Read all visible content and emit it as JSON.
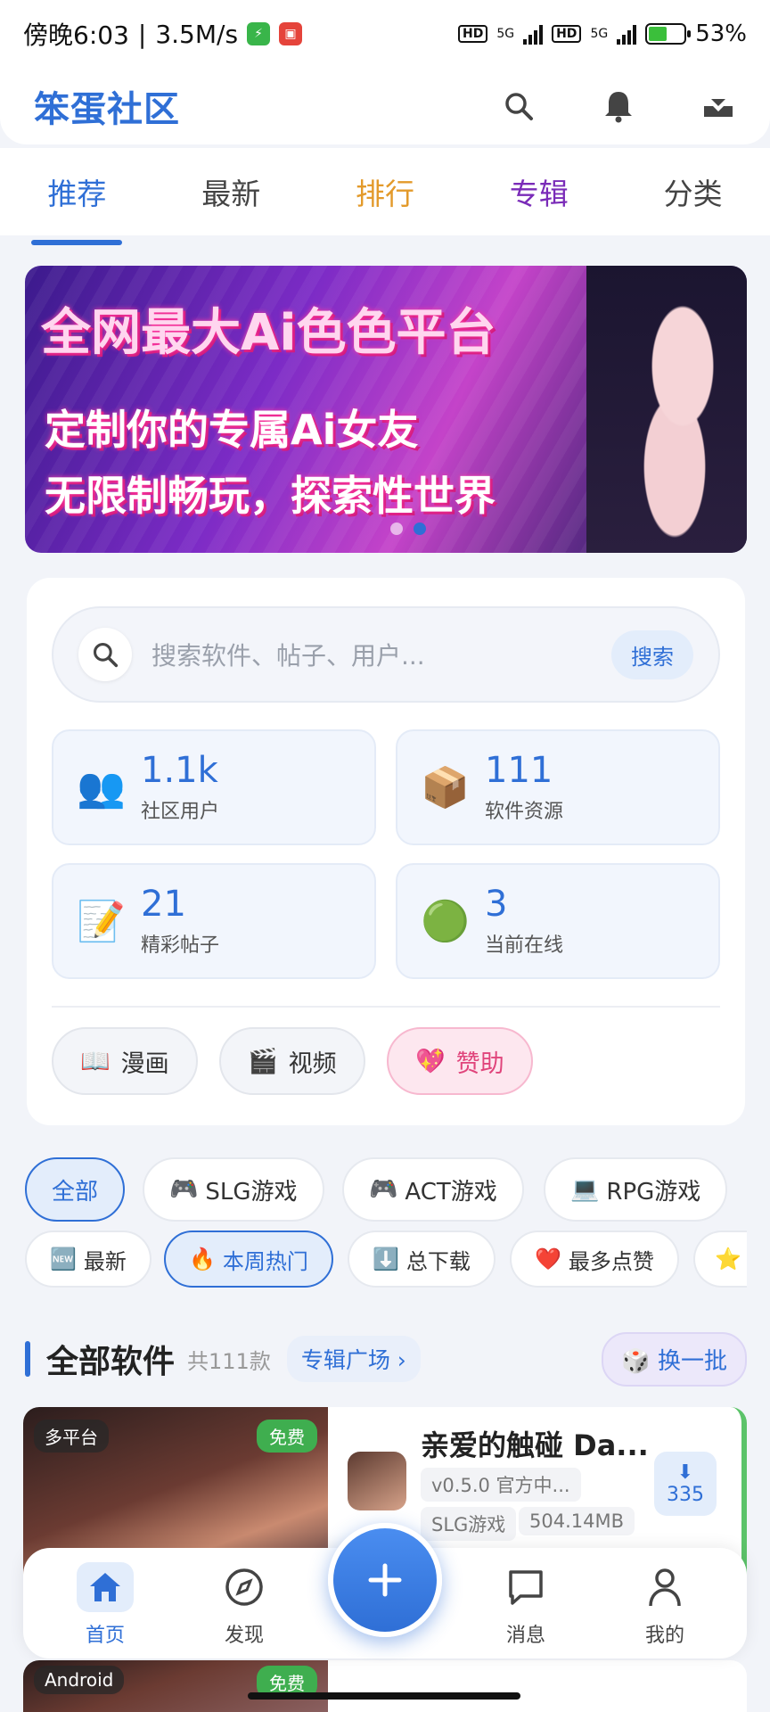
{
  "status_bar": {
    "time": "傍晚6:03",
    "speed": "3.5M/s",
    "battery": "53%",
    "battery_level": 0.53,
    "network_1": "5G",
    "network_2": "5G",
    "hd": "HD"
  },
  "header": {
    "title": "笨蛋社区",
    "icons": [
      "search-icon",
      "bell-icon",
      "download-tray-icon"
    ]
  },
  "tabs": [
    {
      "label": "推荐",
      "color": "#2f6fd6",
      "active": true
    },
    {
      "label": "最新",
      "color": "#444444"
    },
    {
      "label": "排行",
      "color": "#e39a2b"
    },
    {
      "label": "专辑",
      "color": "#7a2bb8"
    },
    {
      "label": "分类",
      "color": "#444444"
    }
  ],
  "banner": {
    "line1": "全网最大Ai色色平台",
    "line2": "定制你的专属Ai女友",
    "line3": "无限制畅玩，探索性世界",
    "active_dot": 2,
    "dot_count": 2
  },
  "search": {
    "placeholder": "搜索软件、帖子、用户...",
    "button": "搜索"
  },
  "stats": [
    {
      "value": "1.1k",
      "label": "社区用户",
      "icon": "👥"
    },
    {
      "value": "111",
      "label": "软件资源",
      "icon": "📦"
    },
    {
      "value": "21",
      "label": "精彩帖子",
      "icon": "📝"
    },
    {
      "value": "3",
      "label": "当前在线",
      "icon": "🟢"
    }
  ],
  "quick_links": [
    {
      "icon": "📖",
      "label": "漫画"
    },
    {
      "icon": "🎬",
      "label": "视频"
    },
    {
      "icon": "💖",
      "label": "赞助"
    }
  ],
  "categories": [
    {
      "icon": "",
      "label": "全部",
      "active": true
    },
    {
      "icon": "🎮",
      "label": "SLG游戏"
    },
    {
      "icon": "🎮",
      "label": "ACT游戏"
    },
    {
      "icon": "💻",
      "label": "RPG游戏"
    }
  ],
  "sorts": [
    {
      "icon": "🆕",
      "label": "最新"
    },
    {
      "icon": "🔥",
      "label": "本周热门",
      "active": true
    },
    {
      "icon": "⬇️",
      "label": "总下载"
    },
    {
      "icon": "❤️",
      "label": "最多点赞"
    },
    {
      "icon": "⭐",
      "label": ""
    }
  ],
  "section": {
    "title": "全部软件",
    "count": "共111款",
    "link": "专辑广场 ›",
    "swap": "🎲 换一批"
  },
  "software": [
    {
      "platform": "多平台",
      "price": "免费",
      "name": "亲爱的触碰 Da...",
      "version": "v0.5.0 官方中...",
      "genre": "SLG游戏",
      "size": "504.14MB",
      "downloads": "335"
    },
    {
      "platform": "Android",
      "price": "免费",
      "name": ""
    }
  ],
  "bottom_nav": [
    {
      "label": "首页",
      "icon": "home-icon",
      "active": true
    },
    {
      "label": "发现",
      "icon": "compass-icon"
    },
    {
      "label": "消息",
      "icon": "message-icon"
    },
    {
      "label": "我的",
      "icon": "profile-icon"
    }
  ]
}
